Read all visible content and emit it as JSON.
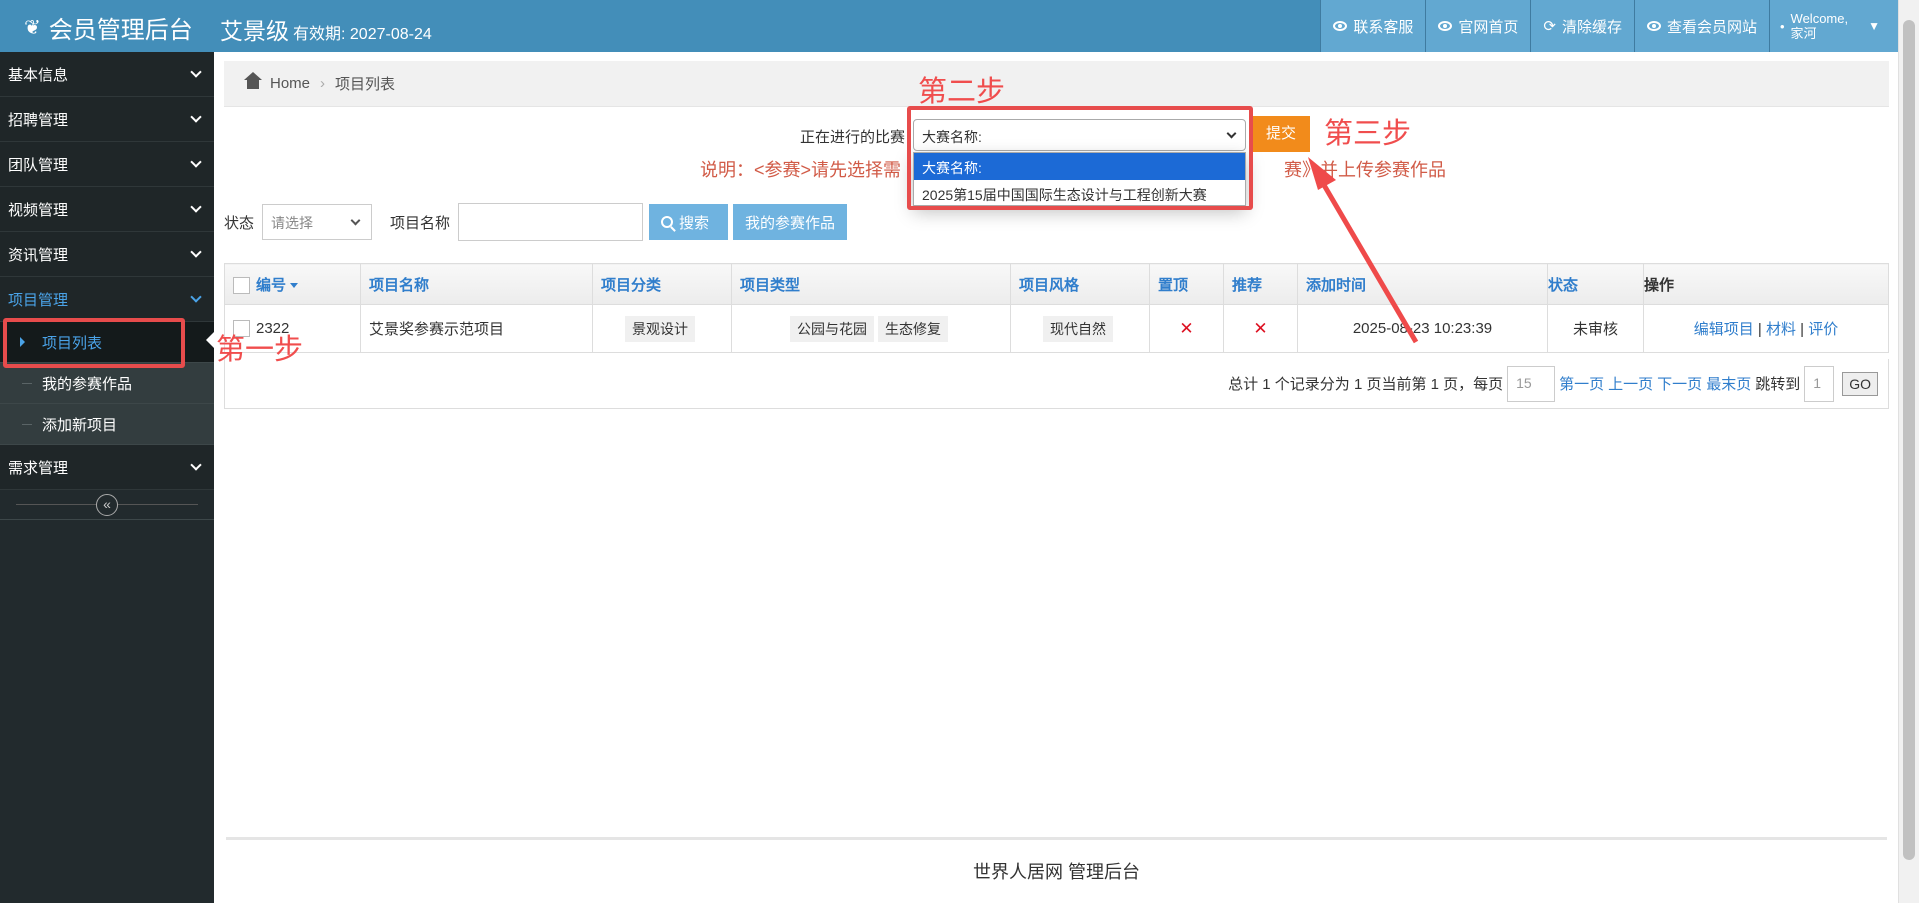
{
  "header": {
    "brand": "会员管理后台",
    "member_level": "艾景级",
    "expiry": "有效期: 2027-08-24",
    "buttons": [
      "联系客服",
      "官网首页",
      "清除缓存",
      "查看会员网站"
    ],
    "welcome": "Welcome,",
    "username": "家河"
  },
  "sidebar": {
    "items": [
      {
        "label": "基本信息"
      },
      {
        "label": "招聘管理"
      },
      {
        "label": "团队管理"
      },
      {
        "label": "视频管理"
      },
      {
        "label": "资讯管理"
      },
      {
        "label": "项目管理"
      }
    ],
    "submenu": [
      "项目列表",
      "我的参赛作品",
      "添加新项目"
    ],
    "after": {
      "label": "需求管理"
    },
    "collapse_icon": "«"
  },
  "breadcrumb": {
    "home": "Home",
    "current": "项目列表"
  },
  "contest": {
    "label": "正在进行的比赛",
    "selected": "大赛名称:",
    "options": [
      "大赛名称:",
      "2025第15届中国国际生态设计与工程创新大赛"
    ],
    "submit": "提交",
    "note_start": "说明：<参赛>请先选择需",
    "note_end": "赛》并上传参赛作品"
  },
  "annotations": {
    "step1": "第一步",
    "step2": "第二步",
    "step3": "第三步"
  },
  "filter": {
    "status_label": "状态",
    "status_placeholder": "请选择",
    "name_label": "项目名称",
    "search": "搜索",
    "my_entries": "我的参赛作品"
  },
  "table": {
    "headers": [
      "编号",
      "项目名称",
      "项目分类",
      "项目类型",
      "项目风格",
      "置顶",
      "推荐",
      "添加时间",
      "状态",
      "操作"
    ],
    "rows": [
      {
        "id": "2322",
        "name": "艾景奖参赛示范项目",
        "category": "景观设计",
        "types": [
          "公园与花园",
          "生态修复"
        ],
        "style": "现代自然",
        "top": "✕",
        "recommend": "✕",
        "time": "2025-08-23 10:23:39",
        "status": "未审核",
        "actions": [
          "编辑项目",
          "材料",
          "评价"
        ]
      }
    ]
  },
  "pager": {
    "summary": "总计 1 个记录分为 1 页当前第 1 页，每页",
    "per_page": "15",
    "first": "第一页",
    "prev": "上一页",
    "next": "下一页",
    "last": "最末页",
    "jump": "跳转到",
    "page": "1",
    "go": "GO"
  },
  "footer": "世界人居网 管理后台"
}
